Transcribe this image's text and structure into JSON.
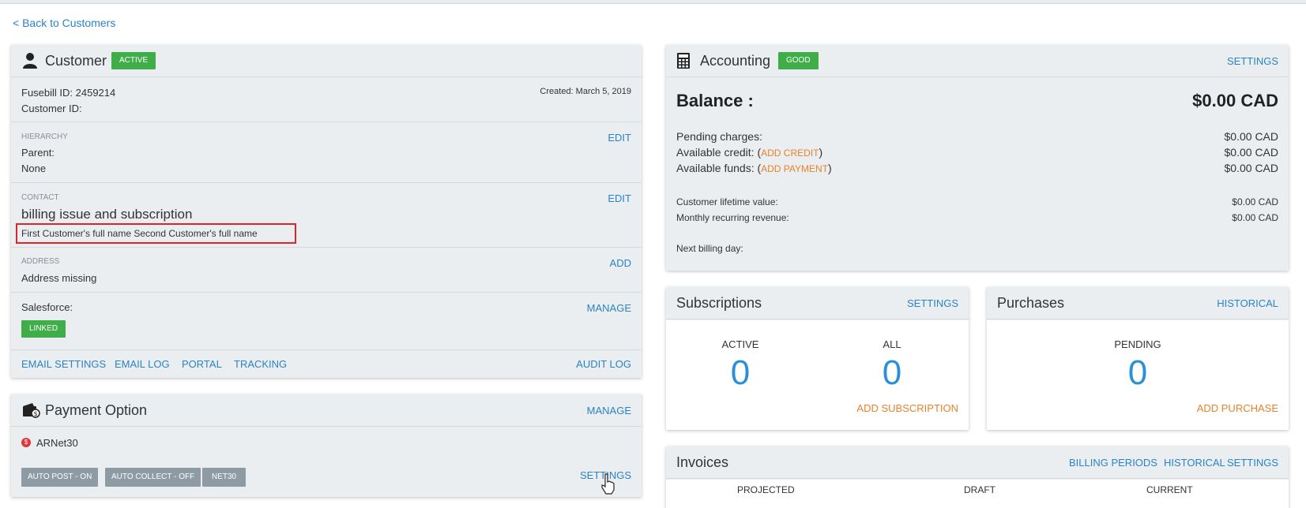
{
  "nav": {
    "back_label": "< Back to Customers"
  },
  "customer": {
    "title": "Customer",
    "status": "ACTIVE",
    "fusebill_id": "Fusebill ID: 2459214",
    "customer_id": "Customer ID:",
    "created": "Created: March 5, 2019",
    "hierarchy": {
      "section_label": "HIERARCHY",
      "edit": "EDIT",
      "parent_label": "Parent:",
      "parent_value": "None"
    },
    "contact": {
      "section_label": "CONTACT",
      "edit": "EDIT",
      "company": "billing issue and subscription",
      "names": "First Customer's full name Second Customer's full name"
    },
    "address": {
      "section_label": "ADDRESS",
      "add": "ADD",
      "value": "Address missing"
    },
    "salesforce": {
      "label": "Salesforce:",
      "manage": "MANAGE",
      "status": "LINKED"
    },
    "links": {
      "email_settings": "EMAIL SETTINGS",
      "email_log": "EMAIL LOG",
      "portal": "PORTAL",
      "tracking": "TRACKING",
      "audit_log": "AUDIT LOG"
    }
  },
  "payment": {
    "title": "Payment Option",
    "manage": "MANAGE",
    "method": "ARNet30",
    "chips": [
      "AUTO POST - ON",
      "AUTO COLLECT - OFF",
      "NET30"
    ],
    "settings": "SETTINGS"
  },
  "accounting": {
    "title": "Accounting",
    "status": "GOOD",
    "settings": "SETTINGS",
    "balance_label": "Balance :",
    "balance_value": "$0.00 CAD",
    "pending_label": "Pending charges:",
    "pending_value": "$0.00 CAD",
    "credit_label": "Available credit: (",
    "credit_link": "ADD CREDIT",
    "credit_close": ")",
    "credit_value": "$0.00 CAD",
    "funds_label": "Available funds: (",
    "funds_link": "ADD PAYMENT",
    "funds_close": ")",
    "funds_value": "$0.00 CAD",
    "ltv_label": "Customer lifetime value:",
    "ltv_value": "$0.00 CAD",
    "mrr_label": "Monthly recurring revenue:",
    "mrr_value": "$0.00 CAD",
    "next_billing_label": "Next billing day:"
  },
  "subscriptions": {
    "title": "Subscriptions",
    "settings": "SETTINGS",
    "active_label": "ACTIVE",
    "active_value": "0",
    "all_label": "ALL",
    "all_value": "0",
    "add": "ADD SUBSCRIPTION"
  },
  "purchases": {
    "title": "Purchases",
    "historical": "HISTORICAL",
    "pending_label": "PENDING",
    "pending_value": "0",
    "add": "ADD PURCHASE"
  },
  "invoices": {
    "title": "Invoices",
    "billing_periods": "BILLING PERIODS",
    "historical": "HISTORICAL",
    "settings": "SETTINGS",
    "col_projected": "PROJECTED",
    "col_draft": "DRAFT",
    "col_current": "CURRENT"
  },
  "colors": {
    "link": "#2a83c4",
    "orange": "#e8822a",
    "green": "#3fae49",
    "highlight": "#d9272e"
  }
}
